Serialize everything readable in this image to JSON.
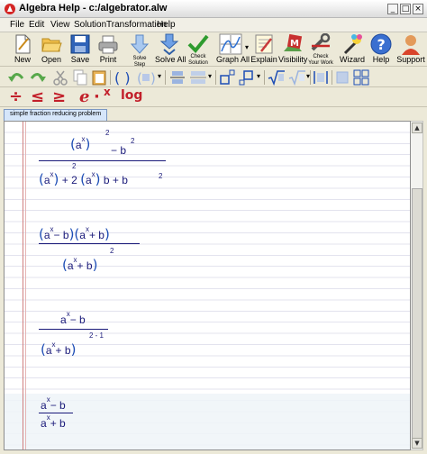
{
  "window": {
    "title": "Algebra Help - c:/algebrator.alw",
    "buttons": {
      "minimize": "_",
      "maximize": "□",
      "close": "×"
    }
  },
  "menu": [
    "File",
    "Edit",
    "View",
    "Solution",
    "Transformation",
    "Help"
  ],
  "toolbar": {
    "new": "New",
    "open": "Open",
    "save": "Save",
    "print": "Print",
    "solve_step_1": "Solve",
    "solve_step_2": "Step",
    "solve_all": "Solve All",
    "check_solution_1": "Check",
    "check_solution_2": "Solution",
    "graph_all": "Graph All",
    "explain": "Explain",
    "visibility": "Visibility",
    "check_work_1": "Check",
    "check_work_2": "Your Work",
    "wizard": "Wizard",
    "help": "Help",
    "support": "Support",
    "dropdown": "▾"
  },
  "toolbar3": {
    "divide": "÷",
    "le": "≤",
    "ge": "≥",
    "e": "e",
    "dot": "·",
    "x": "x",
    "log": "log"
  },
  "tab": {
    "label": "simple fraction reducing problem"
  },
  "colors": {
    "math_text": "#1a1a7a",
    "paren": "#1d4db5",
    "accent_red": "#c21f2a"
  },
  "expressions": {
    "e1": {
      "num": {
        "open": "(",
        "a": "a",
        "x": "x",
        "close": ")",
        "pow": "2",
        "minus": "− b",
        "b_pow": "2"
      },
      "den": {
        "open1": "(",
        "a1": "a",
        "x1": "x",
        "close1": ")",
        "pow1": "2",
        "plus2": "+ 2",
        "open2": "(",
        "a2": "a",
        "x2": "x",
        "close2": ")",
        "b": "b + b",
        "b_pow": "2"
      }
    },
    "e2": {
      "num": {
        "o1": "(",
        "a1": "a",
        "x1": "x",
        "t1": "− b",
        "c1": ")",
        "o2": "(",
        "a2": "a",
        "x2": "x",
        "t2": "+ b",
        "c2": ")"
      },
      "den": {
        "o": "(",
        "a": "a",
        "x": "x",
        "t": "+ b",
        "c": ")",
        "pow": "2"
      }
    },
    "e3": {
      "num": {
        "a": "a",
        "x": "x",
        "t": "− b"
      },
      "den": {
        "o": "(",
        "a": "a",
        "x": "x",
        "t": "+ b",
        "c": ")",
        "pow": "2 - 1"
      }
    },
    "e4": {
      "num": {
        "a": "a",
        "x": "x",
        "t": "− b"
      },
      "den": {
        "a": "a",
        "x": "x",
        "t": "+ b"
      }
    }
  }
}
